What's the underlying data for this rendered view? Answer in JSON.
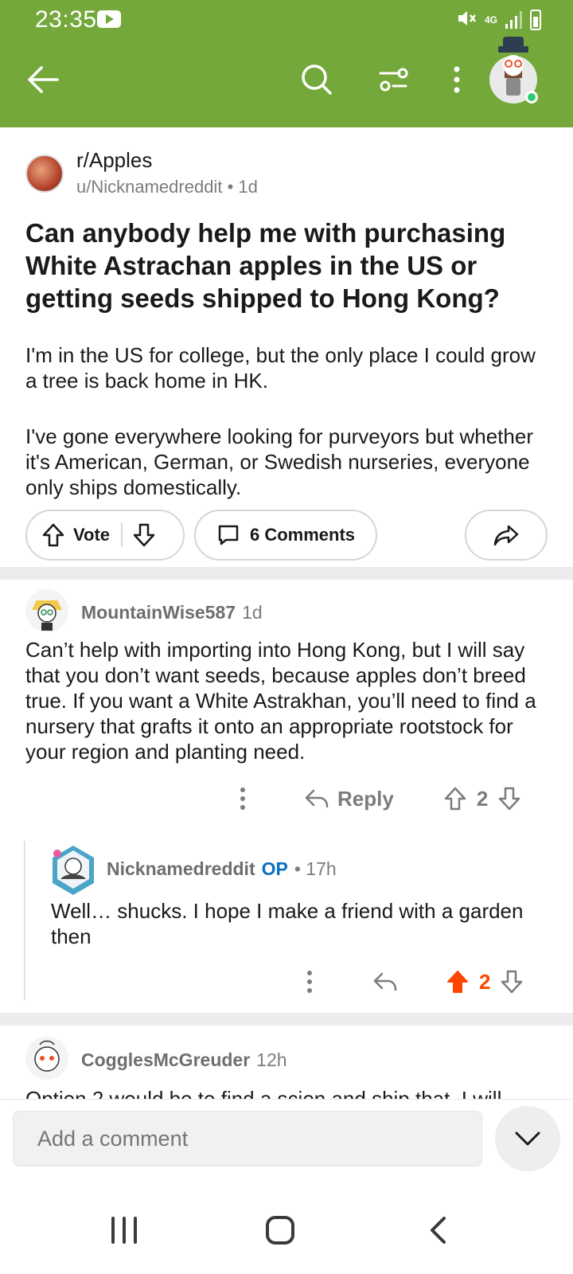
{
  "status_bar": {
    "time": "23:35",
    "network": "4G"
  },
  "header": {
    "back_icon": "arrow-left-icon",
    "search_icon": "search-icon",
    "filter_icon": "sort-filter-icon",
    "more_icon": "more-vertical-icon",
    "accent_color": "#74a83a"
  },
  "post": {
    "subreddit": "r/Apples",
    "author": "u/Nicknamedreddit",
    "age": "1d",
    "title": "Can anybody help me with purchasing White Astrachan apples in the US or getting seeds shipped to Hong Kong?",
    "body": [
      "I'm in the US for college, but the only place I could grow a tree is back home in HK.",
      "I've gone everywhere looking for purveyors but whether it's American, German, or Swedish nurseries, everyone only ships domestically."
    ],
    "vote_label": "Vote",
    "comments_label": "6 Comments"
  },
  "comments": [
    {
      "user": "MountainWise587",
      "age": "1d",
      "text": "Can’t help with importing into Hong Kong, but I will say that you don’t want seeds, because apples don’t breed true. If you want a White Astrakhan, you’ll need to find a nursery that grafts it onto an appropriate rootstock for your  region and planting need.",
      "reply_label": "Reply",
      "score": "2"
    },
    {
      "user": "Nicknamedreddit",
      "op_label": "OP",
      "age": "17h",
      "text": "Well… shucks. I hope I make a friend with a garden then",
      "score": "2",
      "upvoted": true
    },
    {
      "user": "CogglesMcGreuder",
      "age": "12h",
      "text": "Option 2 would be to find a scion and ship that. I will"
    }
  ],
  "bottom": {
    "comment_placeholder": "Add a comment"
  }
}
